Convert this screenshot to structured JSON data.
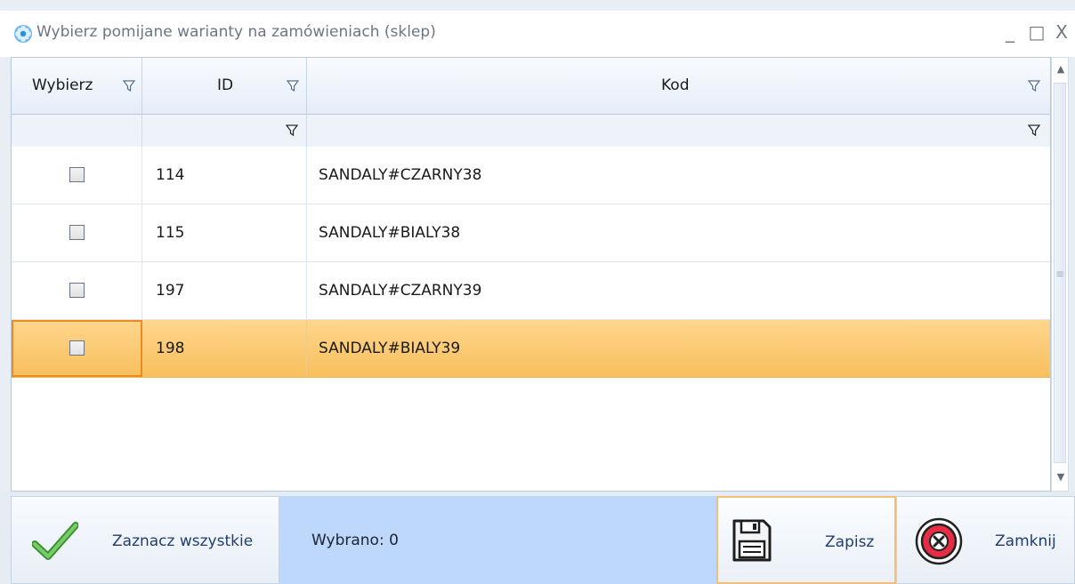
{
  "window": {
    "title": "Wybierz pomijane warianty na zamówieniach (sklep)",
    "icon": "flower-app-icon",
    "controls": {
      "minimize": "_",
      "maximize": "□",
      "close": "X"
    }
  },
  "grid": {
    "columns": [
      {
        "label": "Wybierz",
        "filter_icon": "filter-icon"
      },
      {
        "label": "ID",
        "filter_icon": "filter-icon"
      },
      {
        "label": "Kod",
        "filter_icon": "filter-icon"
      }
    ],
    "rows": [
      {
        "checked": false,
        "id": "114",
        "kod": "SANDALY#CZARNY38",
        "selected": false
      },
      {
        "checked": false,
        "id": "115",
        "kod": "SANDALY#BIALY38",
        "selected": false
      },
      {
        "checked": false,
        "id": "197",
        "kod": "SANDALY#CZARNY39",
        "selected": false
      },
      {
        "checked": false,
        "id": "198",
        "kod": "SANDALY#BIALY39",
        "selected": true
      }
    ],
    "colors": {
      "selected_row": "#f8c25f",
      "focus_border": "#f08a1c",
      "header_bg": "#e4edf8"
    }
  },
  "footer": {
    "select_all_label": "Zaznacz wszystkie",
    "selected_status": "Wybrano: 0",
    "save_label": "Zapisz",
    "close_label": "Zamknij",
    "icons": {
      "select_all": "checkmark-icon",
      "save": "floppy-disk-icon",
      "close": "close-circle-icon"
    },
    "colors": {
      "status_bg": "#bdd8fb",
      "checkmark": "#54b749",
      "close_red": "#d9263b"
    }
  }
}
